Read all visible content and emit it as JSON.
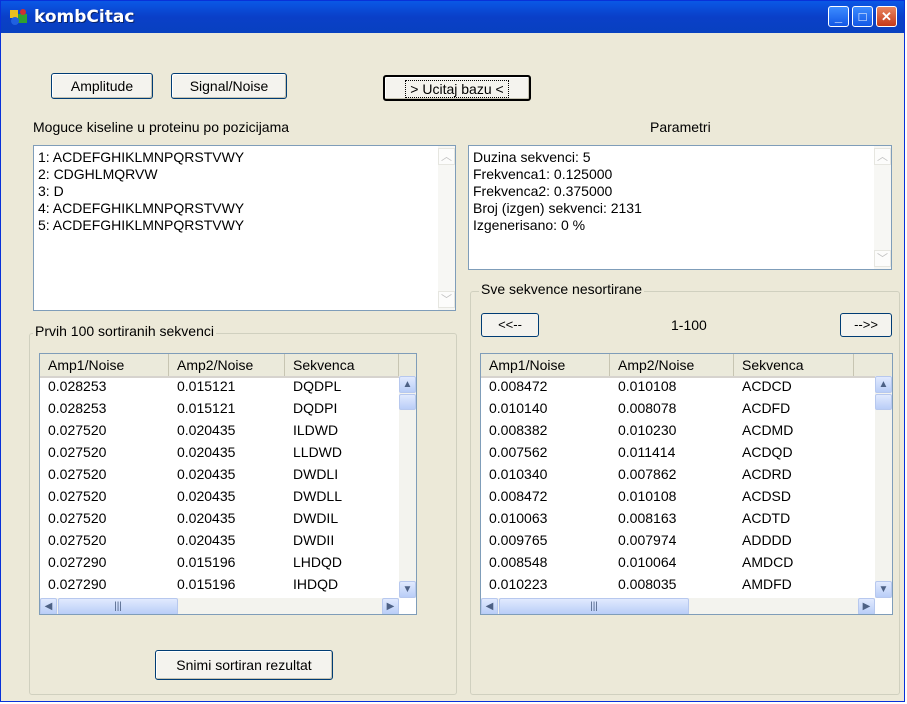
{
  "window": {
    "title": "kombCitac"
  },
  "toolbar": {
    "amplitude_label": "Amplitude",
    "signal_noise_label": "Signal/Noise",
    "ucitaj_label": "> Ucitaj bazu <"
  },
  "left": {
    "caption": "Moguce kiseline u proteinu po pozicijama",
    "acids": [
      "1: ACDEFGHIKLMNPQRSTVWY",
      "2: CDGHLMQRVW",
      "3: D",
      "4: ACDEFGHIKLMNPQRSTVWY",
      "5: ACDEFGHIKLMNPQRSTVWY"
    ],
    "group_label": "Prvih 100 sortiranih sekvenci",
    "columns": [
      "Amp1/Noise",
      "Amp2/Noise",
      "Sekvenca"
    ],
    "rows": [
      [
        "0.028253",
        "0.015121",
        "DQDPL"
      ],
      [
        "0.028253",
        "0.015121",
        "DQDPI"
      ],
      [
        "0.027520",
        "0.020435",
        "ILDWD"
      ],
      [
        "0.027520",
        "0.020435",
        "LLDWD"
      ],
      [
        "0.027520",
        "0.020435",
        "DWDLI"
      ],
      [
        "0.027520",
        "0.020435",
        "DWDLL"
      ],
      [
        "0.027520",
        "0.020435",
        "DWDIL"
      ],
      [
        "0.027520",
        "0.020435",
        "DWDII"
      ],
      [
        "0.027290",
        "0.015196",
        "LHDQD"
      ],
      [
        "0.027290",
        "0.015196",
        "IHDQD"
      ]
    ],
    "save_label": "Snimi sortiran rezultat"
  },
  "right": {
    "caption": "Parametri",
    "params": [
      "Duzina sekvenci: 5",
      "Frekvenca1: 0.125000",
      "Frekvenca2: 0.375000",
      "Broj (izgen) sekvenci: 2131",
      "Izgenerisano: 0 %"
    ],
    "group_label": "Sve sekvence nesortirane",
    "prev_label": "<<--",
    "next_label": "-->>",
    "range_label": "1-100",
    "columns": [
      "Amp1/Noise",
      "Amp2/Noise",
      "Sekvenca"
    ],
    "rows": [
      [
        "0.008472",
        "0.010108",
        "ACDCD"
      ],
      [
        "0.010140",
        "0.008078",
        "ACDFD"
      ],
      [
        "0.008382",
        "0.010230",
        "ACDMD"
      ],
      [
        "0.007562",
        "0.011414",
        "ACDQD"
      ],
      [
        "0.010340",
        "0.007862",
        "ACDRD"
      ],
      [
        "0.008472",
        "0.010108",
        "ACDSD"
      ],
      [
        "0.010063",
        "0.008163",
        "ACDTD"
      ],
      [
        "0.009765",
        "0.007974",
        "ADDDD"
      ],
      [
        "0.008548",
        "0.010064",
        "AMDCD"
      ],
      [
        "0.010223",
        "0.008035",
        "AMDFD"
      ]
    ]
  }
}
